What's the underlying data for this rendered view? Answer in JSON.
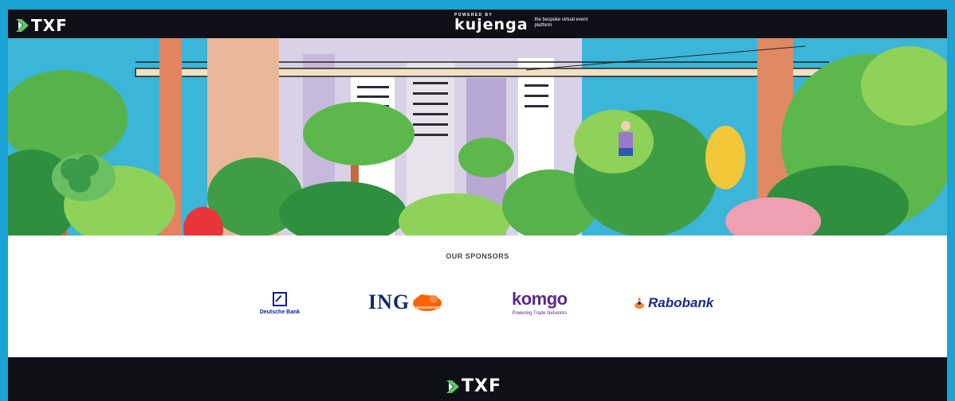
{
  "header": {
    "logo_text": "TXF",
    "powered_by": "POWERED BY",
    "platform_name": "kujenga",
    "platform_tagline": "the bespoke virtual event platform"
  },
  "banner": {
    "icon": "jungle-illustration"
  },
  "sponsors": {
    "title": "OUR SPONSORS",
    "items": [
      {
        "name": "Deutsche Bank",
        "icon": "deutsche-bank-logo",
        "color": "#0b1e8c"
      },
      {
        "name": "ING",
        "icon": "ing-lion-logo",
        "color": "#112a6d"
      },
      {
        "name": "komgo",
        "tagline": "Powering Trade Networks",
        "icon": "komgo-logo",
        "color": "#5b2a8c"
      },
      {
        "name": "Rabobank",
        "icon": "rabobank-logo",
        "color": "#1a2a8a"
      }
    ]
  },
  "footer": {
    "logo_text": "TXF"
  },
  "colors": {
    "page_background": "#1aa3d3",
    "bar_background": "#0f1017",
    "accent_green": "#4fc3c0"
  }
}
